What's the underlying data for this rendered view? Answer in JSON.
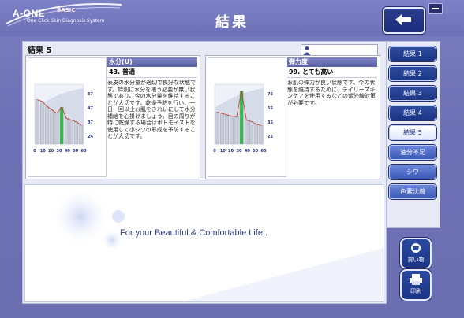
{
  "app": {
    "brand": "A-ONE",
    "tier": "BASIC",
    "subtitle": "One Click Skin Diagnosis System"
  },
  "header": {
    "title": "結果"
  },
  "section": {
    "title": "結果 5"
  },
  "cards": [
    {
      "metric": "水分(U)",
      "score": "43. 普通",
      "desc": "表皮の水分量が適切で良好な状態です。特別に水分を補う必要が無い状態であり、今の水分量を維持することが大切です。乾燥予防を行い、一日一回以上お肌をきれいにして水分補給を心掛けましょう。目の周りが特に乾燥する場合はポトモイストを使用して小ジワの形成を予防することが大切です。",
      "chart_data": {
        "type": "bar",
        "x_ticks": [
          "0",
          "10",
          "20",
          "30",
          "40",
          "50",
          "60"
        ],
        "y_ticks": [
          "57",
          "47",
          "37",
          "24"
        ],
        "values": [
          52,
          50,
          44,
          40,
          36,
          43,
          30,
          28,
          26,
          22
        ],
        "highlight_index": 5,
        "ylim": [
          0,
          70
        ]
      }
    },
    {
      "metric": "弾力度",
      "score": "99. とても高い",
      "desc": "お肌の弾力が良い状態です。今の状態を維持するために、デイリースキンケアを使用するなどの紫外線対策が必要です。",
      "chart_data": {
        "type": "bar",
        "x_ticks": [
          "0",
          "10",
          "20",
          "30",
          "40",
          "50",
          "60"
        ],
        "y_ticks": [
          "75",
          "55",
          "35",
          "25"
        ],
        "values": [
          48,
          46,
          44,
          42,
          41,
          80,
          36,
          34,
          30,
          28
        ],
        "highlight_index": 5,
        "ylim": [
          0,
          90
        ]
      }
    }
  ],
  "tagline": "For your Beautiful & Comfortable Life..",
  "sidebar": {
    "tabs": [
      "結果 1",
      "結果 2",
      "結果 3",
      "結果 4",
      "結果 5",
      "油分不足",
      "シワ",
      "色素沈着"
    ],
    "active_index": 4
  },
  "buttons": {
    "shopping": "買い物",
    "print": "印刷"
  },
  "colors": {
    "accent_blue": "#1d3686",
    "highlight_bar": "#37b84a",
    "bar": "#c9ccd6",
    "trend_line": "#c0392b"
  }
}
